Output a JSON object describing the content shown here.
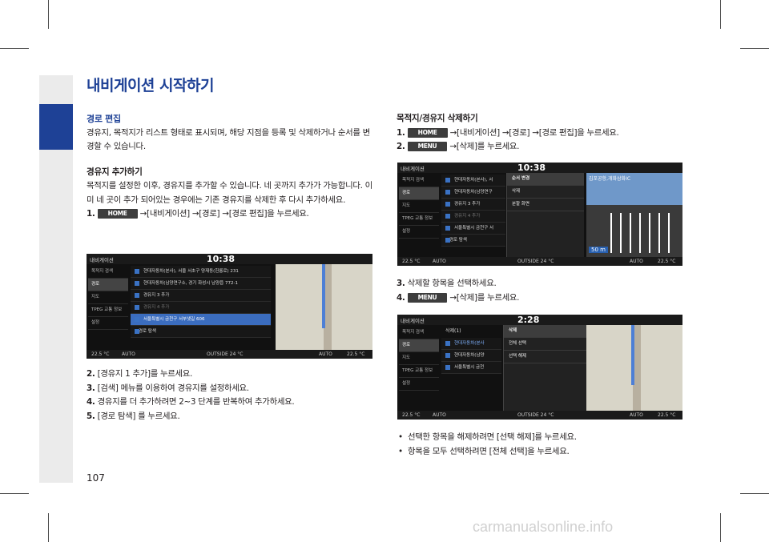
{
  "page": {
    "title": "내비게이션 시작하기",
    "number": "107"
  },
  "left": {
    "section1": {
      "heading": "경로 편집",
      "body": "경유지, 목적지가 리스트 형태로 표시되며, 해당 지점을 등록 및 삭제하거나 순서를 변경할 수 있습니다."
    },
    "section2": {
      "heading": "경유지 추가하기",
      "body": "목적지를 설정한 이후, 경유지를 추가할 수 있습니다. 네 곳까지 추가가 가능합니다. 이미 네 곳이 추가 되어있는 경우에는 기존 경유지를 삭제한 후 다시 추가하세요.",
      "step1": {
        "num": "1.",
        "btn": "HOME",
        "text": "→[내비게이션] →[경로] →[경로 편집]을 누르세요."
      }
    },
    "steps": [
      {
        "num": "2.",
        "text": "[경유지 1 추가]를 누르세요."
      },
      {
        "num": "3.",
        "text": "[검색] 메뉴를 이용하여 경유지를 설정하세요."
      },
      {
        "num": "4.",
        "text": "경유지를 더 추가하려면 2~3 단계를 반복하여 추가하세요."
      },
      {
        "num": "5.",
        "text": "[경로 탐색] 를 누르세요."
      }
    ]
  },
  "right": {
    "heading": "목적지/경유지 삭제하기",
    "step1": {
      "num": "1.",
      "btn": "HOME",
      "text": "→[내비게이션] →[경로] →[경로 편집]을 누르세요."
    },
    "step2": {
      "num": "2.",
      "btn": "MENU",
      "text": "→[삭제]를 누르세요."
    },
    "step3": {
      "num": "3.",
      "text": "삭제할 항목을 선택하세요."
    },
    "step4": {
      "num": "4.",
      "btn": "MENU",
      "text": "→[삭제]를 누르세요."
    },
    "bullets": [
      "선택한 항목을 해제하려면 [선택 해제]를 누르세요.",
      "항목을 모두 선택하려면 [전체 선택]을 누르세요."
    ]
  },
  "screen1": {
    "title": "내비게이션",
    "clock": "10:38",
    "side": [
      "목적지 검색",
      "경로",
      "지도",
      "TPEG 교통 정보",
      "설정"
    ],
    "list": [
      "현대자동차(본사), 서울 서초구 양재동(헌릉로) 231",
      "현대자동차(남양연구소, 경기 화성시 남양읍 772-1",
      "경유지 3 추가",
      "경유지 4 추가",
      "서울특별시 금천구 서부샛길 606"
    ],
    "route_search": "경로 탐색",
    "bottom": [
      "22.5 °C",
      "AUTO",
      "OUTSIDE 24 °C",
      "AUTO",
      "22.5 °C"
    ]
  },
  "screen2": {
    "title": "내비게이션",
    "clock": "10:38",
    "side": [
      "목적지 검색",
      "경로",
      "지도",
      "TPEG 교통 정보",
      "설정"
    ],
    "list": [
      "현대자동차(본사), 서",
      "현대자동차(남양연구",
      "경유지 3 추가",
      "경유지 4 추가",
      "서울특별시 금천구 서"
    ],
    "route_search": "경로 탐색",
    "menu": [
      "순서 변경",
      "삭제",
      "분할 화면"
    ],
    "sign": "김포공항,개화삼화IC",
    "distance": "50 m",
    "bottom": [
      "22.5 °C",
      "AUTO",
      "OUTSIDE 24 °C",
      "AUTO",
      "22.5 °C"
    ]
  },
  "screen3": {
    "title": "내비게이션",
    "clock": "2:28",
    "side": [
      "목적지 검색",
      "경로",
      "지도",
      "TPEG 교통 정보",
      "설정"
    ],
    "delete_header": "삭제(1)",
    "list": [
      "현대자동차(본사",
      "현대자동차(남양",
      "서울특별시 금천"
    ],
    "menu": [
      "삭제",
      "전체 선택",
      "선택 해제"
    ],
    "bottom": [
      "22.5 °C",
      "AUTO",
      "OUTSIDE 24 °C",
      "AUTO",
      "22.5 °C"
    ]
  },
  "watermark": "carmanualsonline.info"
}
